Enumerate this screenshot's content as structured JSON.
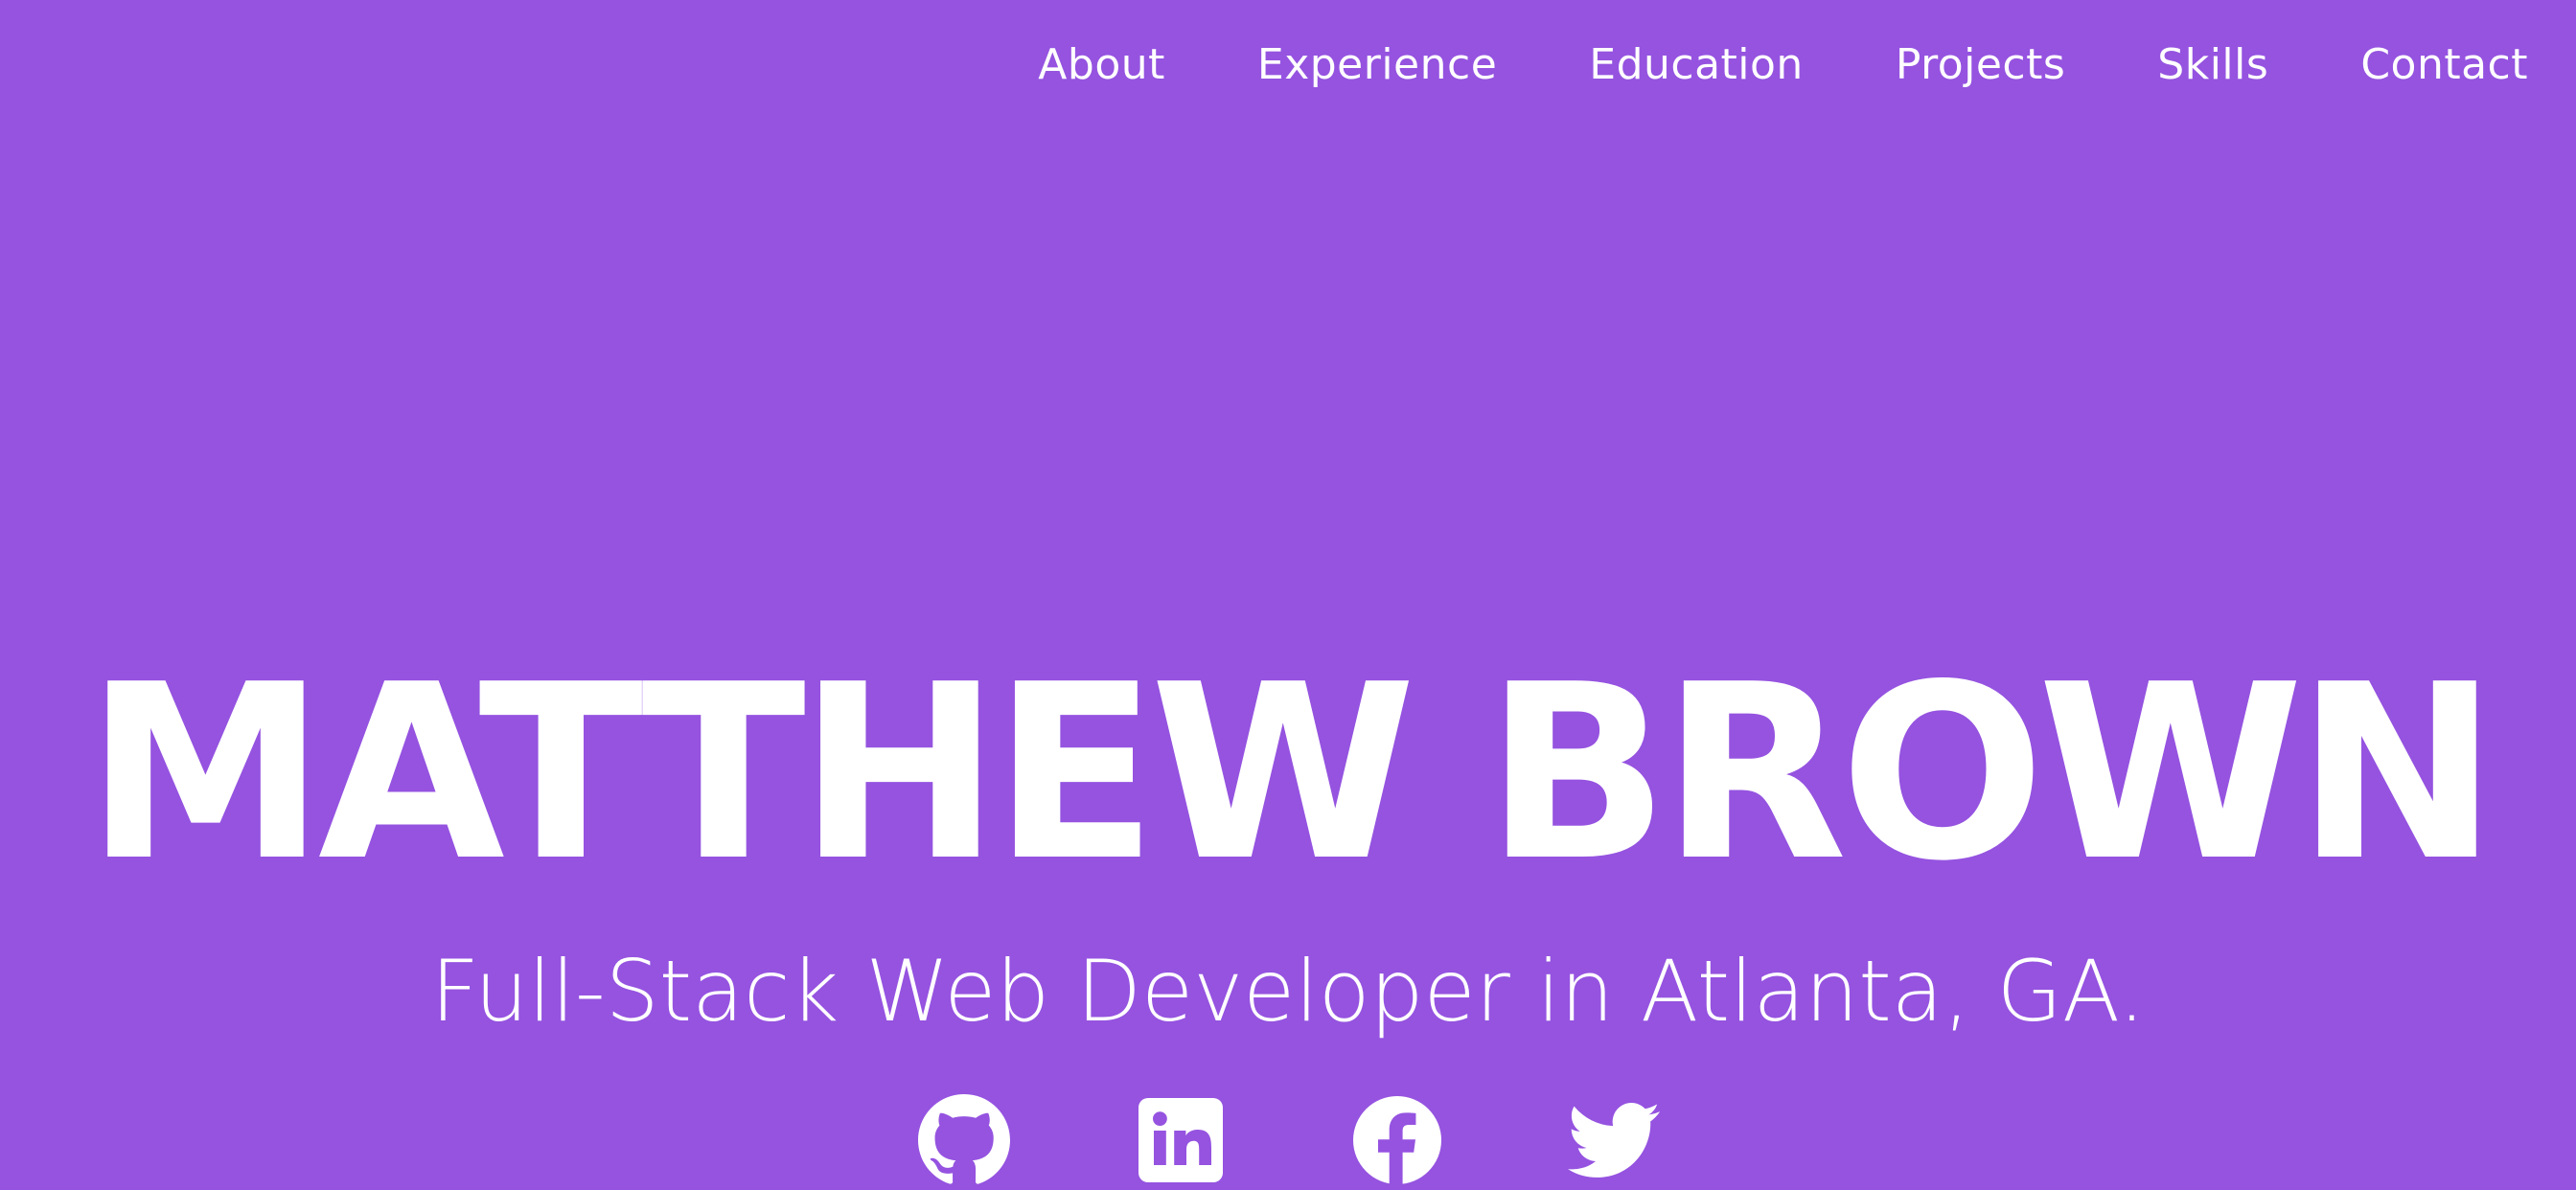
{
  "nav": {
    "items": [
      {
        "label": "About"
      },
      {
        "label": "Experience"
      },
      {
        "label": "Education"
      },
      {
        "label": "Projects"
      },
      {
        "label": "Skills"
      },
      {
        "label": "Contact"
      }
    ]
  },
  "hero": {
    "name": "MATTHEW BROWN",
    "subtitle": "Full-Stack Web Developer in Atlanta, GA."
  },
  "socials": [
    {
      "icon": "github-icon"
    },
    {
      "icon": "linkedin-icon"
    },
    {
      "icon": "facebook-icon"
    },
    {
      "icon": "twitter-icon"
    }
  ],
  "colors": {
    "background": "#9553e0",
    "text": "#ffffff"
  }
}
